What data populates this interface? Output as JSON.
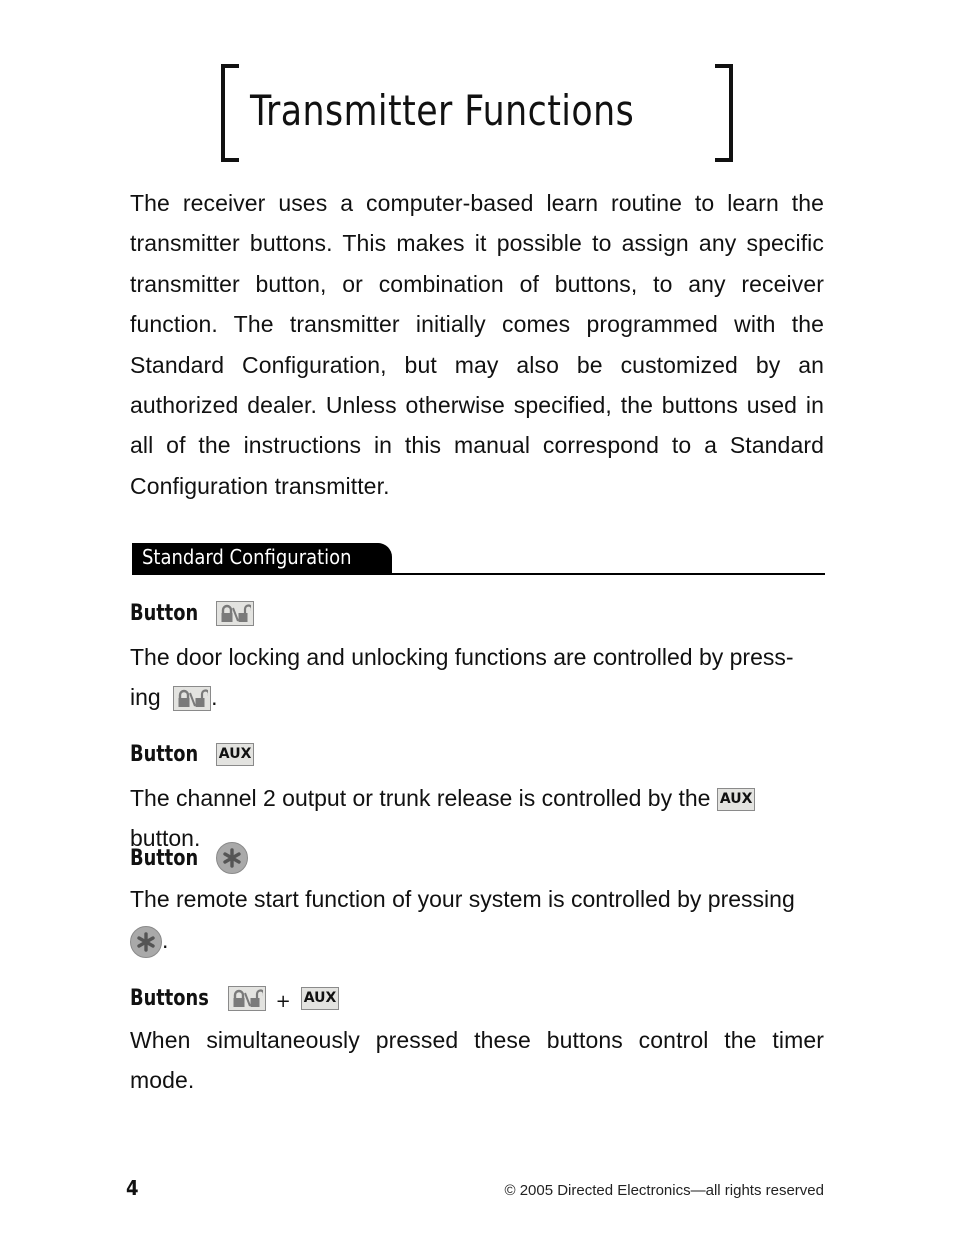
{
  "page": {
    "title": "Transmitter Functions",
    "intro": "The receiver uses a computer-based learn routine to learn the transmitter buttons. This makes it possible to assign any specific transmitter button, or combination of buttons, to any receiver function. The transmitter initially comes programmed with the Standard Configuration, but may also be customized by an authorized dealer. Unless otherwise specified, the buttons used in all of the instructions in this manual correspond to a Standard Configuration transmitter.",
    "section_header": "Standard Configuration"
  },
  "icons": {
    "lock_unlock": "lock-unlock-button-icon",
    "aux": "aux-button-icon",
    "aux_label": "AUX",
    "remote_start": "asterisk-button-icon",
    "plus": "+"
  },
  "buttons": [
    {
      "heading": "Button",
      "icon": "lock-unlock",
      "text_line1": "The door locking and unlocking functions are controlled by press-",
      "text_line2_pre": "ing",
      "text_line2_post": "."
    },
    {
      "heading": "Button",
      "icon": "aux",
      "text_pre": "The channel 2 output or trunk release is controlled by the",
      "text_post": "button."
    },
    {
      "heading": "Button",
      "icon": "remote-start",
      "text_line1": "The remote start function of your system is controlled by pressing",
      "text_line2_post": "."
    },
    {
      "heading": "Buttons",
      "icon": "lock-unlock + aux",
      "text": "When simultaneously pressed these buttons control the timer mode."
    }
  ],
  "footer": {
    "page_number": "4",
    "copyright": "© 2005 Directed Electronics—all rights reserved"
  },
  "colors": {
    "text": "#111111",
    "icon_bg": "#e3e3e0",
    "icon_border": "#8a8a8a",
    "icon_glyph": "#7a7a7a",
    "section_bg": "#000000"
  }
}
